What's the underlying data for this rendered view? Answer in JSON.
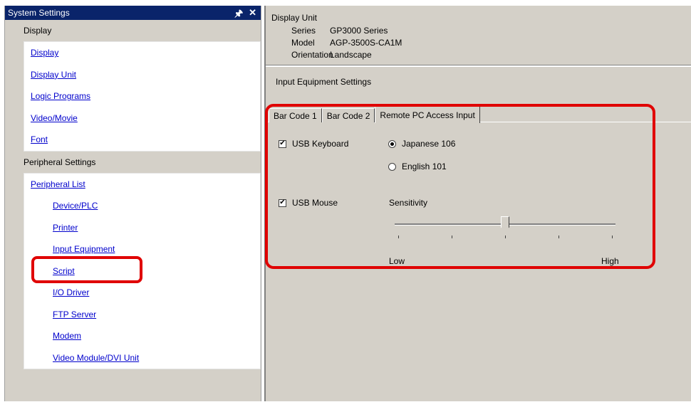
{
  "left_pane": {
    "title": "System Settings",
    "pin_icon": "pin-icon",
    "close_icon": "close-icon",
    "display_header": "Display",
    "display_links": [
      "Display",
      "Display Unit",
      "Logic Programs",
      "Video/Movie",
      "Font"
    ],
    "peripheral_header": "Peripheral Settings",
    "peripheral_list_label": "Peripheral List",
    "peripheral_sublinks": [
      "Device/PLC",
      "Printer",
      "Input Equipment",
      "Script",
      "I/O Driver",
      "FTP Server",
      "Modem",
      "Video Module/DVI Unit"
    ]
  },
  "display_unit": {
    "title": "Display Unit",
    "series_label": "Series",
    "series_value": "GP3000 Series",
    "model_label": "Model",
    "model_value": "AGP-3500S-CA1M",
    "orientation_label": "Orientation",
    "orientation_value": "Landscape"
  },
  "input_equipment": {
    "title": "Input Equipment Settings",
    "tabs": [
      "Bar Code 1",
      "Bar Code 2",
      "Remote PC Access Input"
    ],
    "active_tab": "Remote PC Access Input",
    "usb_keyboard": {
      "label": "USB Keyboard",
      "checked": true
    },
    "keyboard_options": [
      {
        "label": "Japanese 106",
        "selected": true
      },
      {
        "label": "English 101",
        "selected": false
      }
    ],
    "usb_mouse": {
      "label": "USB Mouse",
      "checked": true
    },
    "sensitivity": {
      "label": "Sensitivity",
      "low_label": "Low",
      "high_label": "High",
      "ticks": 5,
      "value": 0.5
    }
  },
  "colors": {
    "highlight": "#e00000",
    "title_bar": "#0a246a",
    "link": "#0000cc",
    "panel": "#d4d0c8"
  }
}
